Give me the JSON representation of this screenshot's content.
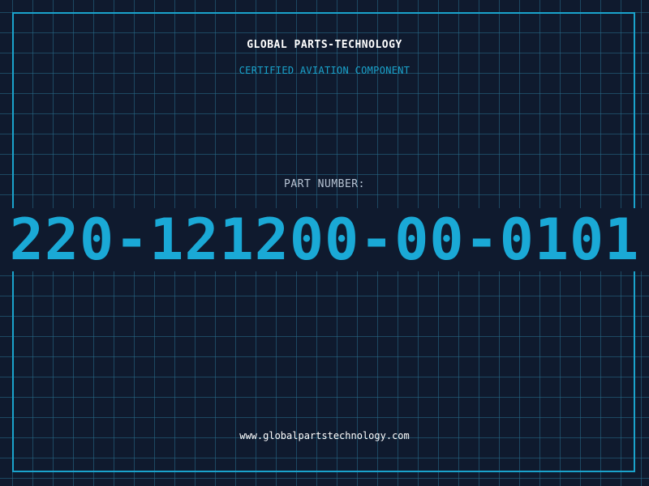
{
  "header": {
    "company": "GLOBAL PARTS-TECHNOLOGY",
    "subtitle": "CERTIFIED AVIATION COMPONENT"
  },
  "part": {
    "label": "PART NUMBER:",
    "number": "220-121200-00-0101"
  },
  "footer": {
    "website": "www.globalpartstechnology.com"
  },
  "colors": {
    "background": "#0f1a2e",
    "grid": "#286e8c",
    "accent": "#1aa3cc",
    "part_number": "#1aa9d6",
    "text": "#ffffff"
  }
}
